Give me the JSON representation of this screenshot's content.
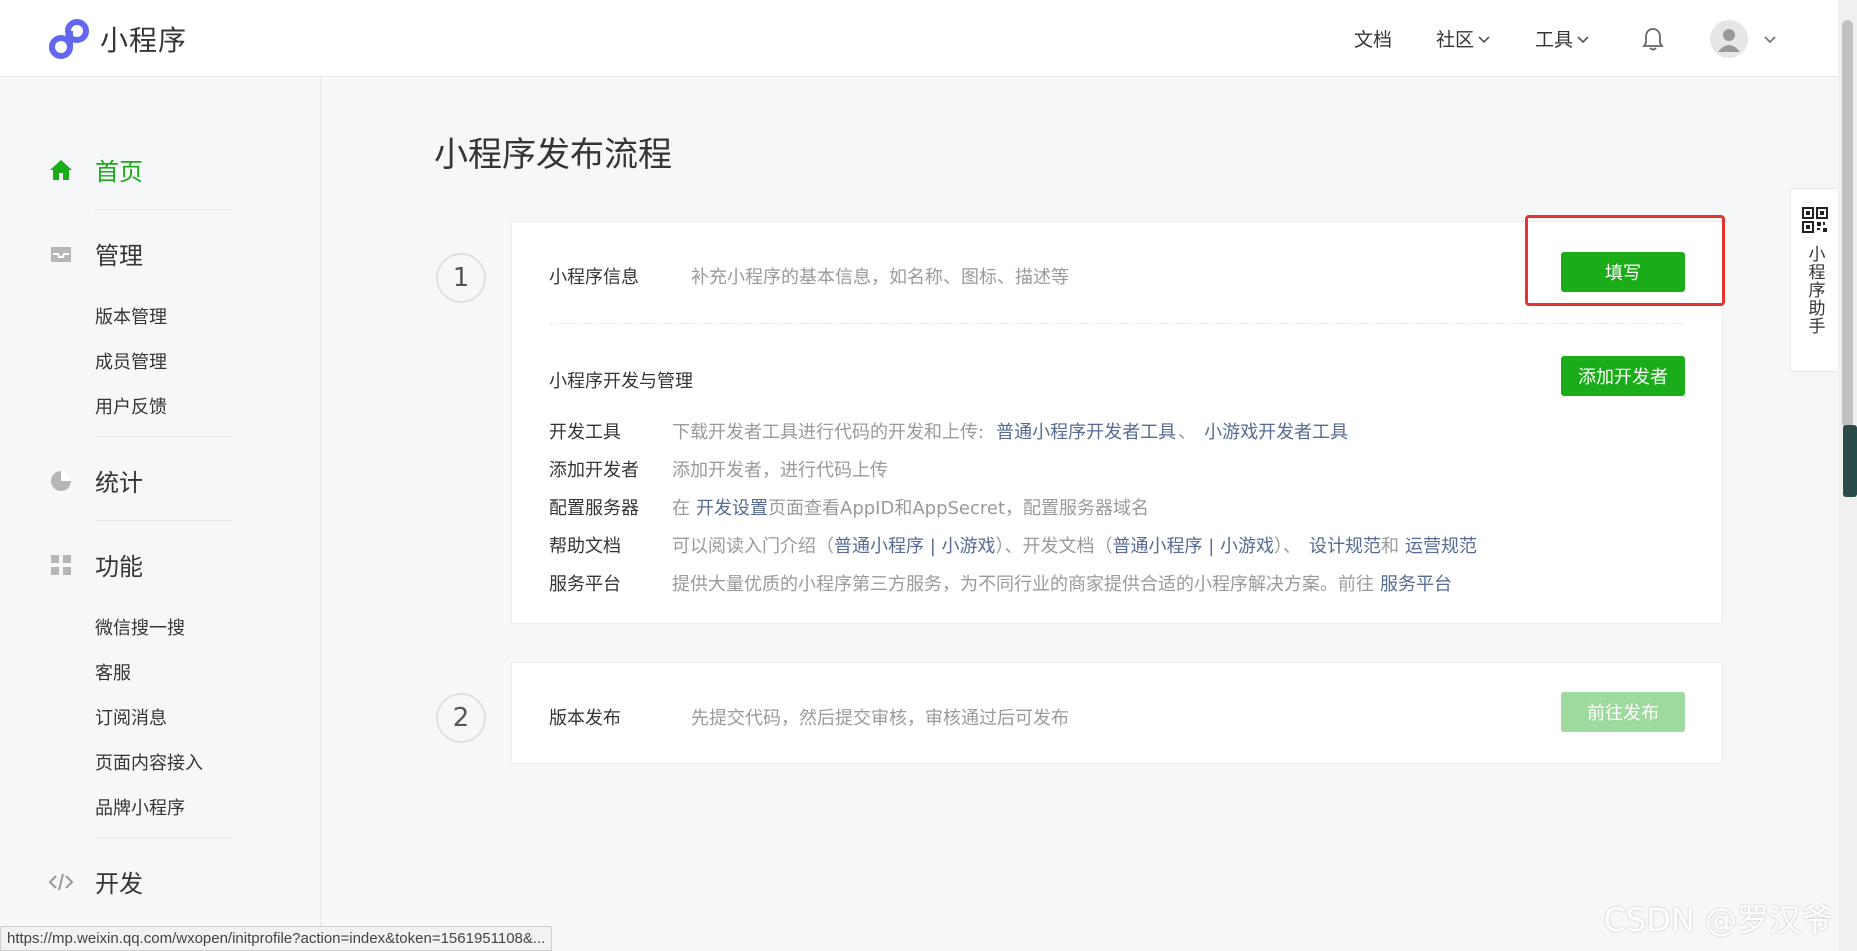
{
  "header": {
    "app_title": "小程序",
    "nav": {
      "docs": "文档",
      "community": "社区",
      "tools": "工具"
    }
  },
  "sidebar": {
    "home": "首页",
    "manage": "管理",
    "manage_items": [
      "版本管理",
      "成员管理",
      "用户反馈"
    ],
    "stats": "统计",
    "features": "功能",
    "feature_items": [
      "微信搜一搜",
      "客服",
      "订阅消息",
      "页面内容接入",
      "品牌小程序"
    ],
    "develop": "开发",
    "active_color": "#1aad19"
  },
  "main": {
    "page_title": "小程序发布流程",
    "step1": {
      "number": "1",
      "info_title": "小程序信息",
      "info_desc": "补充小程序的基本信息，如名称、图标、描述等",
      "fill_button": "填写",
      "dev_title": "小程序开发与管理",
      "add_dev_button": "添加开发者",
      "rows": [
        {
          "label": "开发工具",
          "text1": "下载开发者工具进行代码的开发和上传:",
          "link1": "普通小程序开发者工具",
          "sep": "、",
          "link2": "小游戏开发者工具"
        },
        {
          "label": "添加开发者",
          "text1": "添加开发者，进行代码上传"
        },
        {
          "label": "配置服务器",
          "text1": "在",
          "link1": "开发设置",
          "text2": "页面查看AppID和AppSecret，配置服务器域名"
        },
        {
          "label": "帮助文档",
          "text1": "可以阅读入门介绍（",
          "link1": "普通小程序 | 小游戏",
          "text2": "）、开发文档（",
          "link2": "普通小程序 | 小游戏",
          "text3": "）、",
          "link3": "设计规范",
          "text4": "和",
          "link4": "运营规范"
        },
        {
          "label": "服务平台",
          "text1": "提供大量优质的小程序第三方服务，为不同行业的商家提供合适的小程序解决方案。前往",
          "link1": "服务平台"
        }
      ]
    },
    "step2": {
      "number": "2",
      "title": "版本发布",
      "desc": "先提交代码，然后提交审核，审核通过后可发布",
      "publish_button": "前往发布"
    }
  },
  "helper": {
    "label": "小程序助手"
  },
  "statusbar": {
    "url": "https://mp.weixin.qq.com/wxopen/initprofile?action=index&token=1561951108&..."
  },
  "watermark": "CSDN @罗汉爷",
  "colors": {
    "brand_green": "#1aad19",
    "link": "#576b95",
    "highlight_box": "#e53332"
  }
}
